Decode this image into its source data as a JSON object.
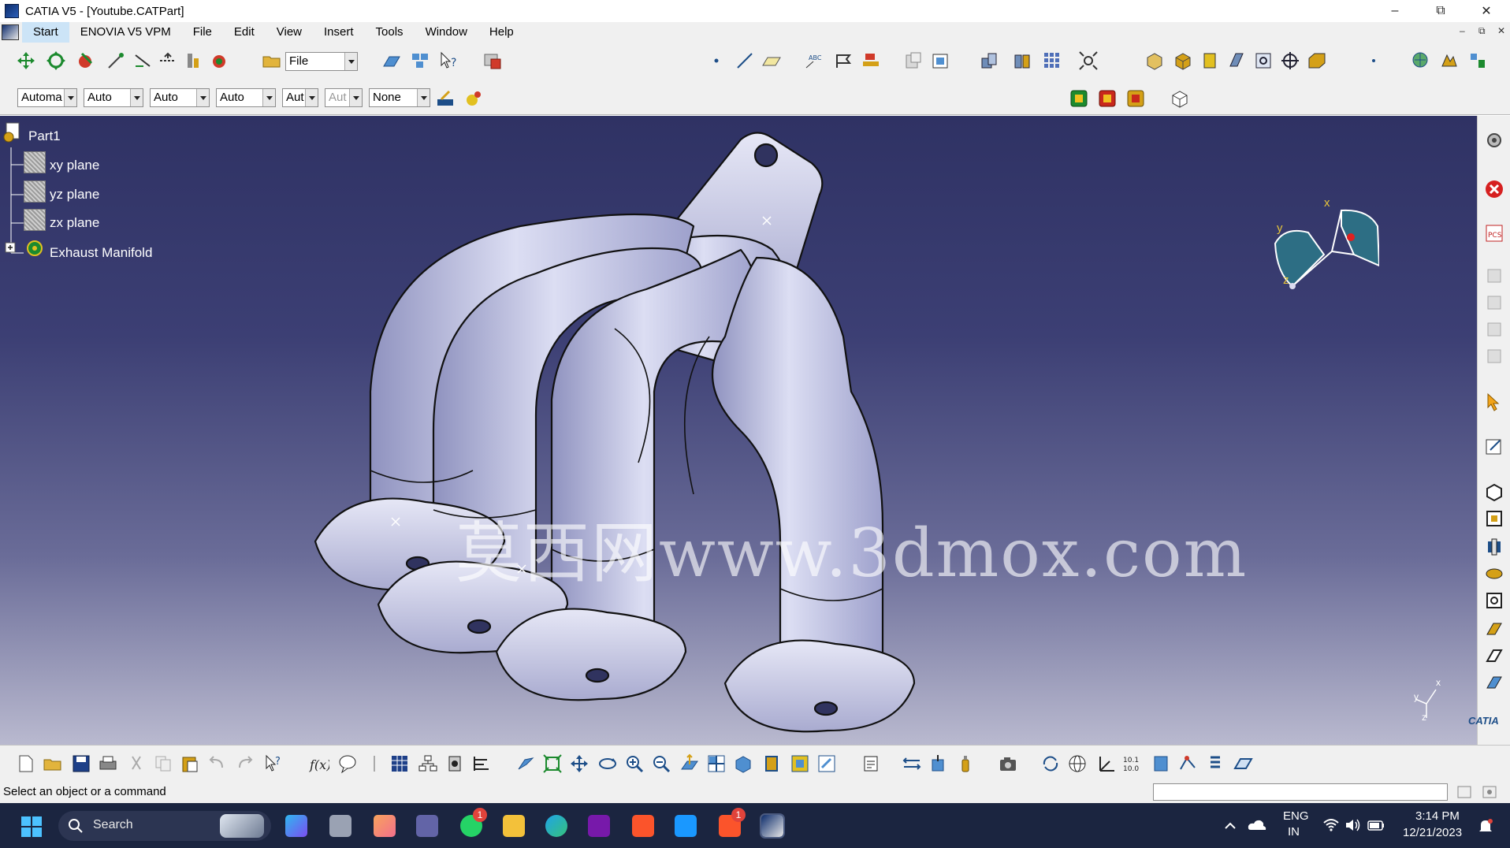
{
  "window": {
    "title": "CATIA V5 - [Youtube.CATPart]",
    "minimize_glyph": "–",
    "restore_glyph": "⧉",
    "close_glyph": "✕"
  },
  "menu": {
    "items": [
      "Start",
      "ENOVIA V5 VPM",
      "File",
      "Edit",
      "View",
      "Insert",
      "Tools",
      "Window",
      "Help"
    ],
    "mdi_controls": [
      "–",
      "⧉",
      "✕"
    ]
  },
  "toolbar_top": {
    "file_combo": "File"
  },
  "toolbar_second": {
    "combos": [
      "Automa",
      "Auto",
      "Auto",
      "Auto",
      "Aut",
      "Aut",
      "None"
    ]
  },
  "tree": {
    "root": "Part1",
    "items": [
      {
        "label": "xy plane",
        "icon": "plane-icon"
      },
      {
        "label": "yz plane",
        "icon": "plane-icon"
      },
      {
        "label": "zx plane",
        "icon": "plane-icon"
      },
      {
        "label": "Exhaust Manifold",
        "icon": "body-icon"
      }
    ]
  },
  "viewport": {
    "watermark": "莫西网www.3dmox.com",
    "compass_labels": {
      "x": "x",
      "y": "y",
      "z": "z"
    },
    "axis_labels": {
      "x": "x",
      "y": "y",
      "z": "z"
    },
    "brand_logo": "CATIA"
  },
  "status_bar": {
    "message": "Select an object or a command",
    "command_input": ""
  },
  "taskbar": {
    "search_placeholder": "Search",
    "language": "ENG",
    "region": "IN",
    "time": "3:14 PM",
    "date": "12/21/2023",
    "whatsapp_badge": "1",
    "chrome_badge": "1"
  },
  "colors": {
    "viewport_top": "#2f3264",
    "viewport_bottom": "#b9b9cf",
    "taskbar": "#1b2540",
    "part_fill": "#c9cbe6",
    "compass": "#2d6e84"
  }
}
